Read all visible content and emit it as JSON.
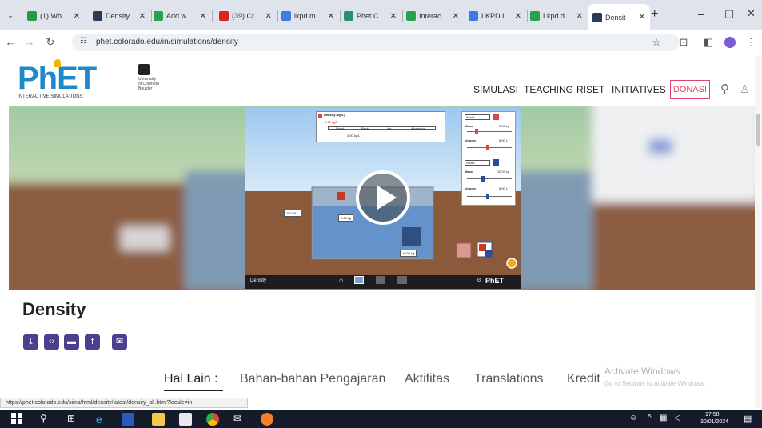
{
  "browser": {
    "tabs": [
      {
        "label": "(1) Wh",
        "favicon_color": "#2b9a47"
      },
      {
        "label": "Density",
        "favicon_color": "#2b3a55"
      },
      {
        "label": "Add w",
        "favicon_color": "#27a24f"
      },
      {
        "label": "(39) Cr",
        "favicon_color": "#e02020"
      },
      {
        "label": "lkpd m",
        "favicon_color": "#3f7be5"
      },
      {
        "label": "Phet C",
        "favicon_color": "#2c8f6a"
      },
      {
        "label": "Interac",
        "favicon_color": "#27a24f"
      },
      {
        "label": "LKPD I",
        "favicon_color": "#3f7be5"
      },
      {
        "label": "Lkpd d",
        "favicon_color": "#27a24f"
      },
      {
        "label": "Densit",
        "favicon_color": "#2b3a55"
      }
    ],
    "url": "phet.colorado.edu/in/simulations/density",
    "status_url": "https://phet.colorado.edu/sims/html/density/latest/density_all.html?locale=in"
  },
  "site": {
    "logo_text": "PhET",
    "logo_subtitle": "INTERACTIVE SIMULATIONS",
    "university": [
      "University",
      "of Colorado",
      "Boulder"
    ],
    "nav": [
      "SIMULASI",
      "TEACHING",
      "RISET",
      "INITIATIVES"
    ],
    "donate_label": "DONASI"
  },
  "sim": {
    "readout_title": "Density (kg/L)",
    "readout_value": "0.40 kg/L",
    "readout_value2": "2.00 kg/L",
    "scale_labels": [
      "Wood",
      "Brick",
      "Ice",
      "Aluminum"
    ],
    "liquid_label": "Water",
    "mass_label_left": "157.00 L",
    "mass_label_mid": "2.00 kg",
    "mass_label_right": "10.00 kg",
    "panel": {
      "block_a": "Wood",
      "mass_a": "Mass",
      "mass_a_val": "2.00 kg",
      "volume_a": "Volume",
      "volume_a_val": "5.00 L",
      "block_b": "Stone",
      "mass_b": "Mass",
      "mass_b_val": "10.00 kg",
      "volume_b": "Volume",
      "volume_b_val": "5.00 L"
    },
    "footer_title": "Density",
    "phet_mark": "PhET"
  },
  "page": {
    "title": "Density",
    "tabs": [
      "Hal Lain :",
      "Bahan-bahan Pengajaran",
      "Aktifitas",
      "Translations",
      "Kredit"
    ]
  },
  "windows": {
    "watermark_title": "Activate Windows",
    "watermark_sub": "Go to Settings to activate Windows.",
    "time": "17:58",
    "date": "30/01/2024"
  }
}
